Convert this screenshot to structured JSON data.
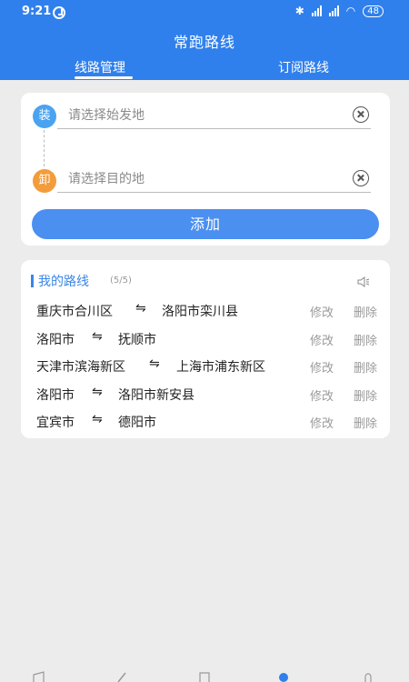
{
  "status_bar": {
    "time": "9:21",
    "battery": "48",
    "network": "HD"
  },
  "header": {
    "title": "常跑路线",
    "tabs": [
      {
        "label": "线路管理",
        "active": true
      },
      {
        "label": "订阅路线",
        "active": false
      }
    ]
  },
  "form": {
    "load_badge": "装",
    "unload_badge": "卸",
    "from_placeholder": "请选择始发地",
    "from_value": "",
    "to_placeholder": "请选择目的地",
    "to_value": "",
    "add_label": "添加"
  },
  "routes": {
    "title": "我的路线",
    "count": "(5/5)",
    "swap_symbol": "⇋",
    "edit_label": "修改",
    "delete_label": "删除",
    "items": [
      {
        "from": "重庆市合川区",
        "to": "洛阳市栾川县"
      },
      {
        "from": "洛阳市",
        "to": "抚顺市"
      },
      {
        "from": "天津市滨海新区",
        "to": "上海市浦东新区"
      },
      {
        "from": "洛阳市",
        "to": "洛阳市新安县"
      },
      {
        "from": "宜宾市",
        "to": "德阳市"
      }
    ]
  },
  "colors": {
    "primary": "#2f80ed",
    "button": "#4b8ff0",
    "load_badge": "#4aa3f0",
    "unload_badge": "#f39c3c",
    "background": "#ececec"
  },
  "icons": {
    "load": "circle-badge-load",
    "unload": "circle-badge-unload",
    "clear": "clear-circle-icon",
    "speaker": "speaker-icon"
  }
}
